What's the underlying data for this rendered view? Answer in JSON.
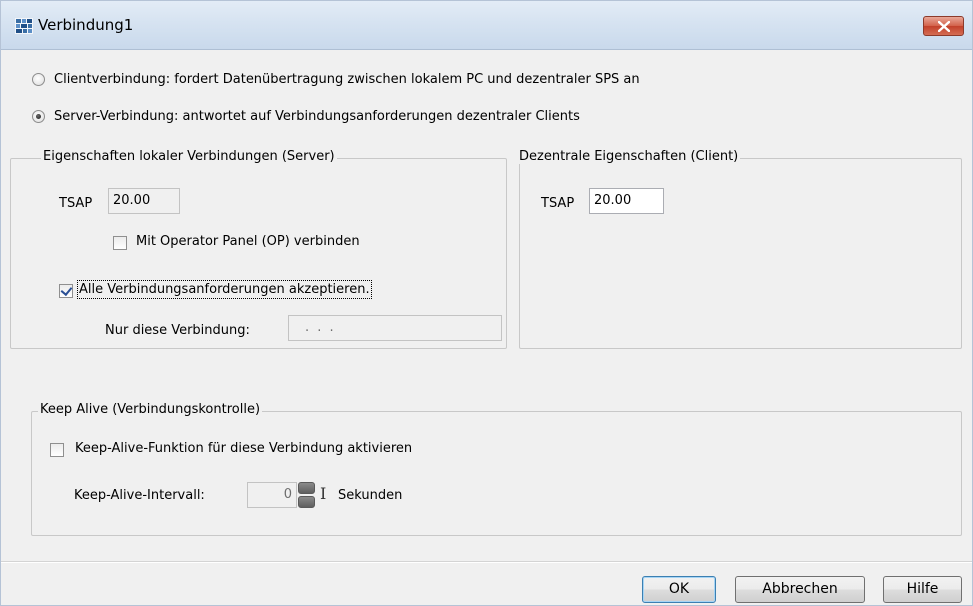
{
  "window": {
    "title": "Verbindung1",
    "icon": "connection-icon",
    "close_icon": "close-icon"
  },
  "connection_mode": {
    "options": [
      {
        "label": "Clientverbindung: fordert Datenübertragung zwischen lokalem PC und dezentraler SPS an",
        "selected": false
      },
      {
        "label": "Server-Verbindung: antwortet auf Verbindungsanforderungen dezentraler Clients",
        "selected": true
      }
    ]
  },
  "local_group": {
    "title": "Eigenschaften lokaler Verbindungen (Server)",
    "tsap_label": "TSAP",
    "tsap_value": "20.00",
    "op_checkbox_label": "Mit Operator Panel (OP) verbinden",
    "op_checked": false,
    "accept_all_label": "Alle Verbindungsanforderungen akzeptieren.",
    "accept_all_checked": true,
    "only_this_label": "Nur diese Verbindung:",
    "only_this_value": ". . ."
  },
  "remote_group": {
    "title": "Dezentrale Eigenschaften (Client)",
    "tsap_label": "TSAP",
    "tsap_value": "20.00"
  },
  "keepalive_group": {
    "title": "Keep Alive (Verbindungskontrolle)",
    "checkbox_label": "Keep-Alive-Funktion für diese Verbindung aktivieren",
    "checked": false,
    "interval_label": "Keep-Alive-Intervall:",
    "interval_value": "0",
    "unit_label": "Sekunden",
    "cursor_glyph": "I"
  },
  "buttons": {
    "ok": "OK",
    "cancel": "Abbrechen",
    "help": "Hilfe"
  },
  "colors": {
    "titlebar": "#d6e3f1",
    "close_button": "#c2402a",
    "dialog_bg": "#f0f0f0"
  }
}
